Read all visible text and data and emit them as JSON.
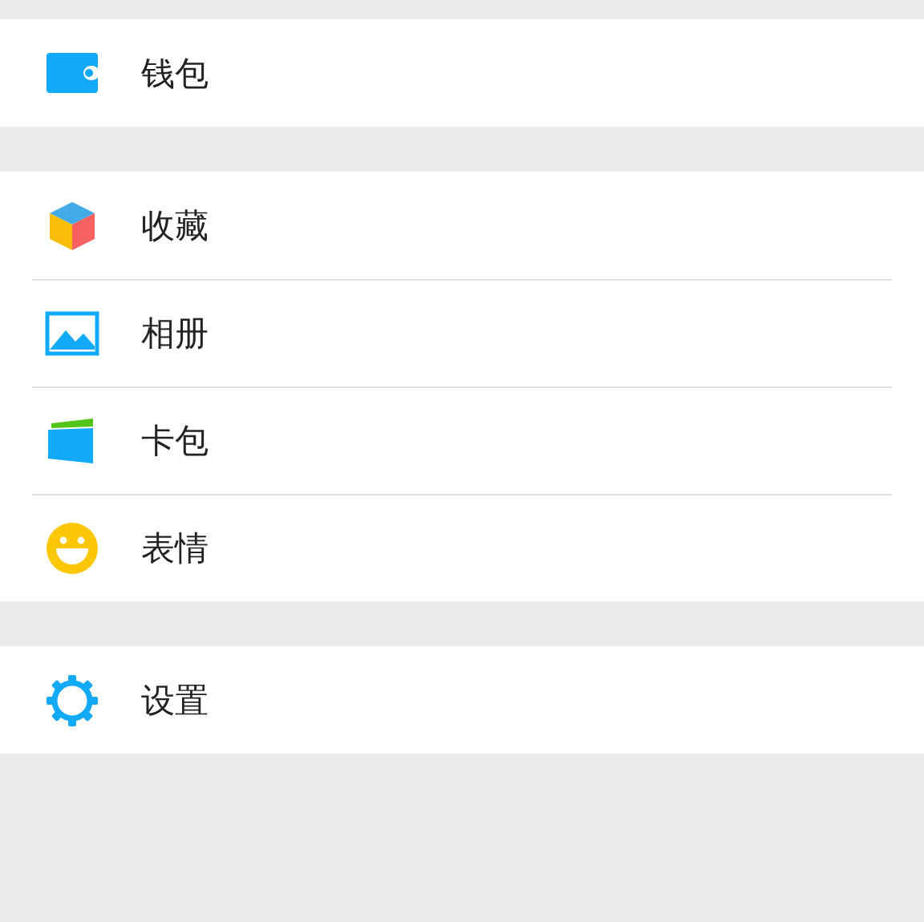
{
  "groups": [
    {
      "items": [
        {
          "kind": "wallet",
          "label": "钱包"
        }
      ]
    },
    {
      "items": [
        {
          "kind": "cube",
          "label": "收藏"
        },
        {
          "kind": "image",
          "label": "相册"
        },
        {
          "kind": "card",
          "label": "卡包"
        },
        {
          "kind": "smiley",
          "label": "表情"
        }
      ]
    },
    {
      "items": [
        {
          "kind": "gear",
          "label": "设置"
        }
      ]
    }
  ]
}
